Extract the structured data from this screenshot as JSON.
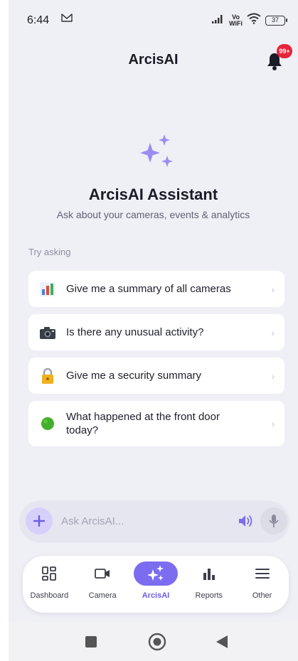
{
  "status_bar": {
    "time": "6:44",
    "vo_label": "Vo",
    "wifi_label": "WiFi",
    "battery": "37"
  },
  "header": {
    "title": "ArcisAI",
    "notification_badge": "99+"
  },
  "hero": {
    "title": "ArcisAI Assistant",
    "subtitle": "Ask about your cameras, events & analytics"
  },
  "suggestions": {
    "heading": "Try asking",
    "items": [
      {
        "icon": "bar-chart-icon",
        "label": "Give me a summary of all cameras"
      },
      {
        "icon": "camera-icon",
        "label": "Is there any unusual activity?"
      },
      {
        "icon": "lock-icon",
        "label": "Give me a security summary"
      },
      {
        "icon": "green-circle-icon",
        "label": "What happened at the front door today?"
      }
    ]
  },
  "input": {
    "placeholder": "Ask ArcisAI..."
  },
  "bottom_nav": {
    "items": [
      {
        "label": "Dashboard",
        "icon": "dashboard-icon",
        "active": false
      },
      {
        "label": "Camera",
        "icon": "video-camera-icon",
        "active": false
      },
      {
        "label": "ArcisAI",
        "icon": "sparkle-icon",
        "active": true
      },
      {
        "label": "Reports",
        "icon": "bar-chart-icon",
        "active": false
      },
      {
        "label": "Other",
        "icon": "menu-icon",
        "active": false
      }
    ]
  },
  "colors": {
    "accent": "#7b6cf0",
    "accent_light": "#d6d0fb",
    "background": "#efeff6",
    "badge": "#e5243a"
  }
}
